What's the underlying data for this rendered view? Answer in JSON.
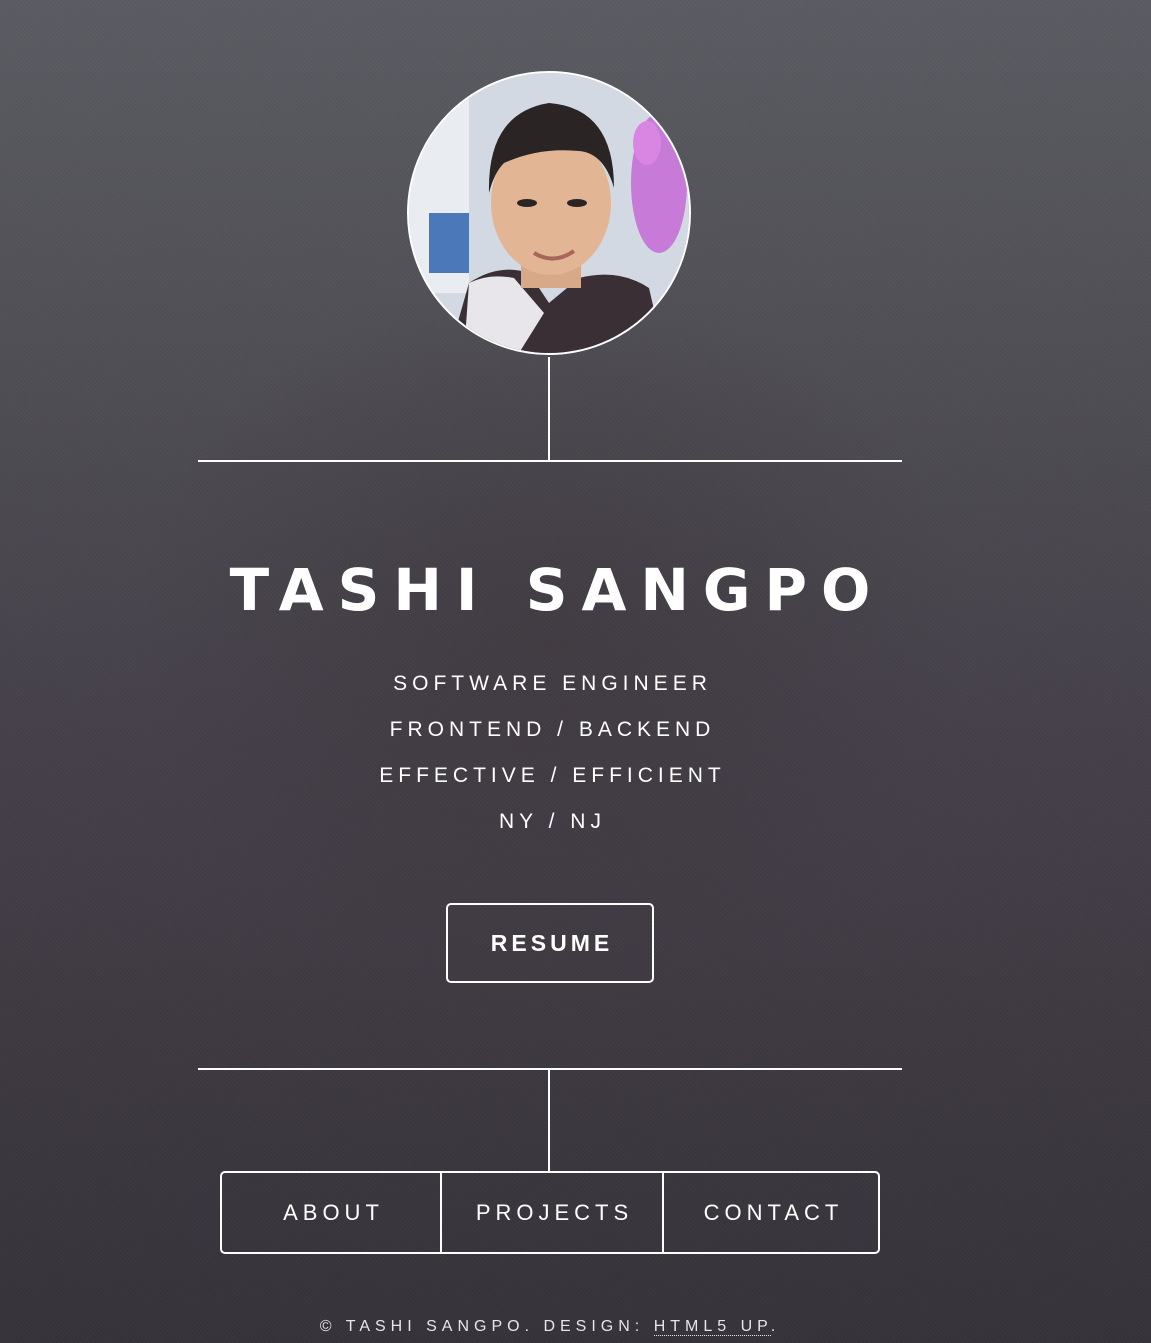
{
  "profile": {
    "avatar_icon": "profile-photo",
    "name": "TASHI SANGPO",
    "taglines": [
      "SOFTWARE ENGINEER",
      "FRONTEND / BACKEND",
      "EFFECTIVE / EFFICIENT",
      "NY / NJ"
    ]
  },
  "actions": {
    "resume_label": "RESUME"
  },
  "nav": {
    "items": [
      {
        "label": "ABOUT"
      },
      {
        "label": "PROJECTS"
      },
      {
        "label": "CONTACT"
      }
    ]
  },
  "footer": {
    "copyright": "© TASHI SANGPO. DESIGN: ",
    "link_label": "HTML5 UP",
    "end": "."
  },
  "colors": {
    "text": "#ffffff",
    "background_top": "#5b5c63",
    "background_bottom": "#36333b"
  }
}
